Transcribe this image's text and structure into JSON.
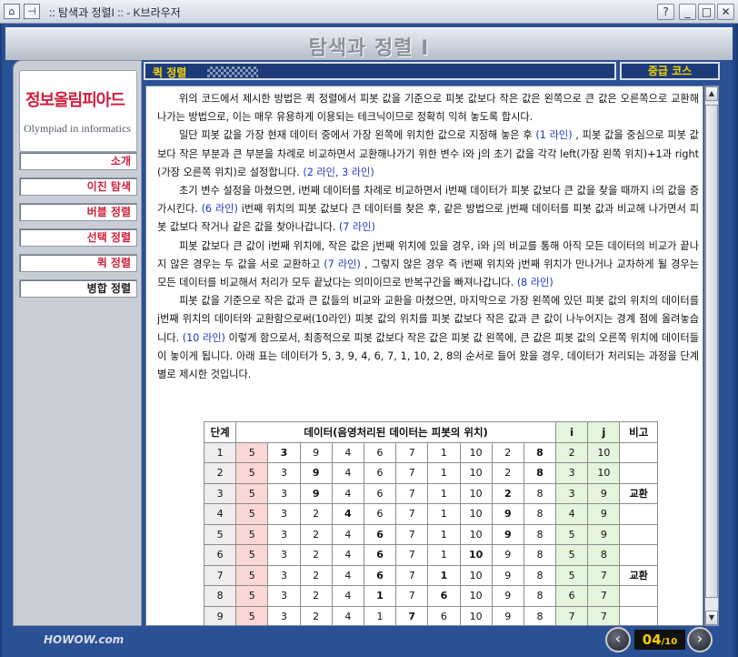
{
  "window": {
    "title": ":: 탐색과 정렬I :: - K브라우저",
    "help_label": "?",
    "minimize_label": "_",
    "maximize_label": "□",
    "close_label": "✕"
  },
  "header": {
    "title": "탐색과 정렬 I"
  },
  "sidebar": {
    "logo_ko": "정보올림피아드",
    "logo_en": "Olympiad in informatics",
    "items": [
      {
        "label": "소개"
      },
      {
        "label": "이진 탐색"
      },
      {
        "label": "버블 정렬"
      },
      {
        "label": "선택 정렬"
      },
      {
        "label": "퀵 정렬"
      },
      {
        "label": "병합 정렬"
      }
    ],
    "footer_brand": "HOWOW.com"
  },
  "section": {
    "title": "퀵 정렬",
    "level": "중급 코스"
  },
  "content": {
    "p1": "위의 코드에서 제시한 방법은 퀵 정렬에서 피봇 값을 기준으로 피봇 값보다 작은 값은 왼쪽으로 큰 값은 오른쪽으로 교환해 나가는 방법으로, 이는 매우 유용하게 이용되는 테크닉이므로 정확히 익혀 놓도록 합시다.",
    "p2a": "일단 피봇 값을 가장 현재 데이터 중에서 가장 왼쪽에 위치한 값으로 지정해 놓은 후 ",
    "p2l1": "(1 라인)",
    "p2b": " , 피봇 값을 중심으로 피봇 값보다 작은 부분과 큰 부분을 차례로 비교하면서 교환해나가기 위한 변수 i와 j의 초기 값을 각각 left(가장 왼쪽 위치)+1과 right(가장 오른쪽 위치)로 설정합니다. ",
    "p2l2": "(2 라인, 3 라인)",
    "p3a": "초기 변수 설정을 마쳤으면, i번째 데이터를 차례로 비교하면서 i번째 데이터가 피봇 값보다 큰 값을 찾을 때까지 i의 값을 증가시킨다. ",
    "p3l1": "(6 라인)",
    "p3b": " i번째 위치의 피봇 값보다 큰 데이터를 찾은 후, 같은 방법으로 j번째 데이터를 피봇 값과 비교해 나가면서 피봇 값보다 작거나 같은 값을 찾아나갑니다. ",
    "p3l2": "(7 라인)",
    "p4a": "피봇 값보다 큰 값이 i번째 위치에, 작은 값은 j번째 위치에 있을 경우, i와 j의 비교를 통해 아직 모든 데이터의 비교가 끝나지 않은 경우는 두 값을 서로 교환하고 ",
    "p4l1": "(7 라인)",
    "p4b": " , 그렇지 않은 경우 즉 i번째 위치와 j번째 위치가 만나거나 교차하게 될 경우는 모든 데이터를 비교해서 처리가 모두 끝났다는 의미이므로 반복구간을 빠져나갑니다. ",
    "p4l2": "(8 라인)",
    "p5a": "피봇 값을 기준으로 작은 값과 큰 값들의 비교와 교환을 마쳤으면, 마지막으로 가장 왼쪽에 있던 피봇 값의 위치의 데이터를 j번째 위치의 데이터와 교환함으로써(10라인) 피봇 값의 위치를 피봇 값보다 작은 값과 큰 값이 나누어지는 경계 점에 올려놓습니다. ",
    "p5l1": "(10 라인)",
    "p5b": " 이렇게 함으로서, 최종적으로 피봇 값보다 작은 값은 피봇 값 왼쪽에, 큰 값은 피봇 값의 오른쪽 위치에 데이터들이 놓이게 됩니다. 아래 표는 데이터가 5, 3, 9, 4, 6, 7, 1, 10, 2, 8의 순서로 들어 왔을 경우, 데이터가 처리되는 과정을 단계별로 제시한 것입니다."
  },
  "table": {
    "headers": {
      "step": "단계",
      "data": "데이터(음영처리된 데이터는 피봇의 위치)",
      "i": "i",
      "j": "j",
      "note": "비고"
    },
    "rows": [
      {
        "step": "1",
        "data": [
          "5",
          "3",
          "9",
          "4",
          "6",
          "7",
          "1",
          "10",
          "2",
          "8"
        ],
        "bold": [
          1,
          9
        ],
        "i": "2",
        "j": "10",
        "note": ""
      },
      {
        "step": "2",
        "data": [
          "5",
          "3",
          "9",
          "4",
          "6",
          "7",
          "1",
          "10",
          "2",
          "8"
        ],
        "bold": [
          2,
          9
        ],
        "i": "3",
        "j": "10",
        "note": ""
      },
      {
        "step": "3",
        "data": [
          "5",
          "3",
          "9",
          "4",
          "6",
          "7",
          "1",
          "10",
          "2",
          "8"
        ],
        "bold": [
          2,
          8
        ],
        "i": "3",
        "j": "9",
        "note": "교환"
      },
      {
        "step": "4",
        "data": [
          "5",
          "3",
          "2",
          "4",
          "6",
          "7",
          "1",
          "10",
          "9",
          "8"
        ],
        "bold": [
          3,
          8
        ],
        "i": "4",
        "j": "9",
        "note": ""
      },
      {
        "step": "5",
        "data": [
          "5",
          "3",
          "2",
          "4",
          "6",
          "7",
          "1",
          "10",
          "9",
          "8"
        ],
        "bold": [
          4,
          8
        ],
        "i": "5",
        "j": "9",
        "note": ""
      },
      {
        "step": "6",
        "data": [
          "5",
          "3",
          "2",
          "4",
          "6",
          "7",
          "1",
          "10",
          "9",
          "8"
        ],
        "bold": [
          4,
          7
        ],
        "i": "5",
        "j": "8",
        "note": ""
      },
      {
        "step": "7",
        "data": [
          "5",
          "3",
          "2",
          "4",
          "6",
          "7",
          "1",
          "10",
          "9",
          "8"
        ],
        "bold": [
          4,
          6
        ],
        "i": "5",
        "j": "7",
        "note": "교환"
      },
      {
        "step": "8",
        "data": [
          "5",
          "3",
          "2",
          "4",
          "1",
          "7",
          "6",
          "10",
          "9",
          "8"
        ],
        "bold": [
          4,
          6
        ],
        "i": "6",
        "j": "7",
        "note": ""
      },
      {
        "step": "9",
        "data": [
          "5",
          "3",
          "2",
          "4",
          "1",
          "7",
          "6",
          "10",
          "9",
          "8"
        ],
        "bold": [
          5
        ],
        "i": "7",
        "j": "7",
        "note": ""
      }
    ]
  },
  "pager": {
    "current": "04",
    "total": "/10",
    "prev_label": "‹",
    "next_label": "›"
  },
  "colors": {
    "accent_yellow": "#f5d200",
    "menu_red": "#d0213c",
    "link_blue": "#1f33c4",
    "pivot_fill": "#f9d7d4",
    "ij_fill": "#e4f4dd"
  }
}
